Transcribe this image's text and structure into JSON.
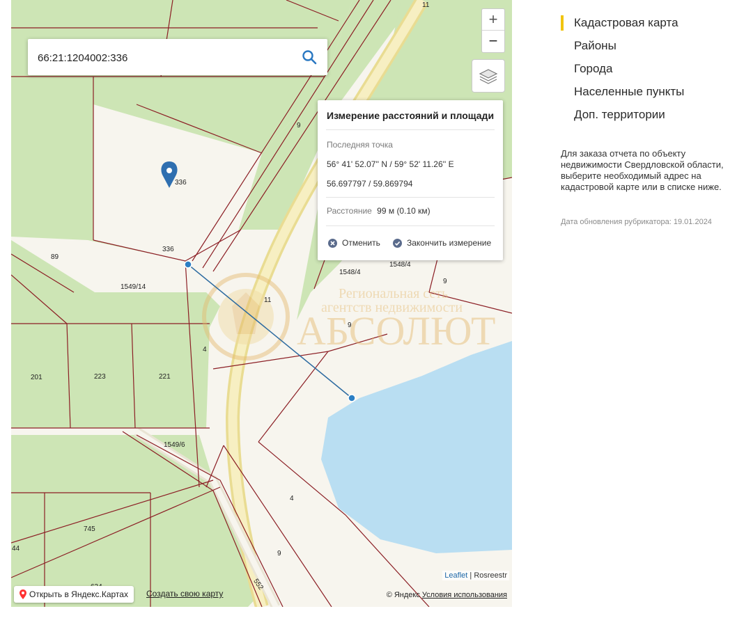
{
  "search": {
    "value": "66:21:1204002:336",
    "icon": "search-icon"
  },
  "zoom": {
    "in_label": "+",
    "out_label": "−"
  },
  "layers": {
    "icon": "layers-icon"
  },
  "measure_panel": {
    "title": "Измерение расстояний и площади",
    "last_point_label": "Последняя точка",
    "coords_dms": "56° 41' 52.07'' N / 59° 52' 11.26'' E",
    "coords_decimal": "56.697797 / 59.869794",
    "distance_label": "Расстояние",
    "distance_value": "99 м (0.10 км)",
    "cancel_label": "Отменить",
    "finish_label": "Закончить измерение"
  },
  "map_labels": {
    "l11_top": "11",
    "l9_a": "9",
    "l336_marker": "336",
    "l336": "336",
    "l89": "89",
    "l1549_14": "1549/14",
    "l1548_4a": "1548/4",
    "l1548_4b": "1548/4",
    "l9_b": "9",
    "l11_mid": "11",
    "l9_c": "9",
    "l4_a": "4",
    "l201": "201",
    "l223": "223",
    "l221": "221",
    "l1549_6": "1549/6",
    "l4_b": "4",
    "l745": "745",
    "l44": "44",
    "l9_d": "9",
    "l634": "634",
    "l552": "552"
  },
  "watermark": {
    "line1": "Региональная сеть",
    "line2": "агентств недвижимости",
    "brand": "АБСОЛЮТ"
  },
  "attribution": {
    "leaflet": "Leaflet",
    "separator": "|",
    "rosreestr": "Rosreestr"
  },
  "yandex": {
    "open_label": "Открыть в Яндекс.Картах",
    "create_label": "Создать свою карту",
    "copyright": "© Яндекс",
    "terms": "Условия использования"
  },
  "sidebar": {
    "items": [
      {
        "label": "Кадастровая карта",
        "active": true
      },
      {
        "label": "Районы",
        "active": false
      },
      {
        "label": "Города",
        "active": false
      },
      {
        "label": "Населенные пункты",
        "active": false
      },
      {
        "label": "Доп. территории",
        "active": false
      }
    ],
    "info_text": "Для заказа отчета по объекту недвижимости Свердловской области, выберите необходимый адрес на кадастровой карте или в списке ниже.",
    "update_date": "Дата обновления рубрикатора: 19.01.2024"
  },
  "colors": {
    "forest": "#cde5b5",
    "cleared": "#f7f5ee",
    "water": "#b9def2",
    "road": "#f1e7a9",
    "parcel_line": "#8b1e24",
    "measure_line": "#2c6aa0",
    "accent": "#f1c40f"
  }
}
